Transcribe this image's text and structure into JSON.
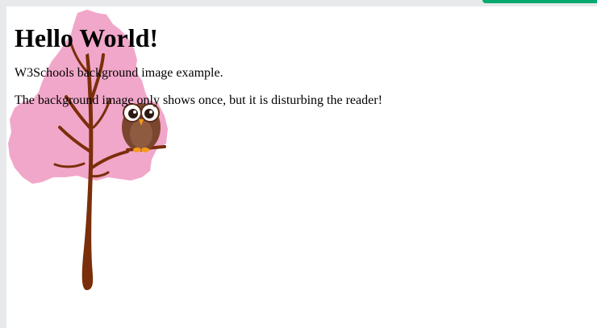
{
  "page": {
    "heading": "Hello World!",
    "paragraphs": [
      "W3Schools background image example.",
      "The background image only shows once, but it is disturbing the reader!"
    ]
  },
  "background_image": {
    "icon": "tree-with-owl-illustration"
  },
  "colors": {
    "blossom": "#f1a7c9",
    "trunk": "#7a2e0a",
    "owl_body": "#7b4630",
    "owl_beak": "#f59a1b",
    "accent_tab": "#04aa6d"
  }
}
